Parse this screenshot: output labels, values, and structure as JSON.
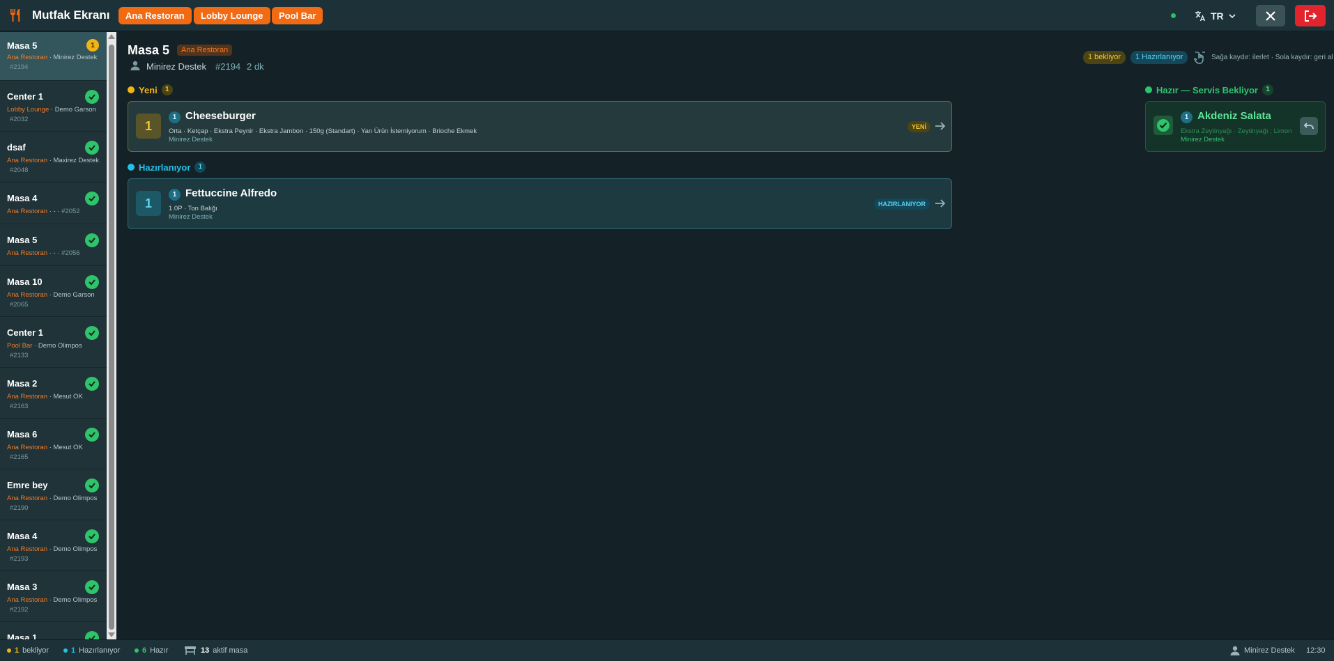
{
  "header": {
    "title": "Mutfak Ekranı",
    "areas": [
      "Ana Restoran",
      "Lobby Lounge",
      "Pool Bar"
    ],
    "language": "TR"
  },
  "orders": [
    {
      "name": "Masa 5",
      "area": "Ana Restoran",
      "waiter": "Minirez Destek",
      "number": "#2194",
      "status": "pending",
      "badge": "1"
    },
    {
      "name": "Center 1",
      "area": "Lobby Lounge",
      "waiter": "Demo Garson",
      "number": "#2032",
      "status": "done"
    },
    {
      "name": "dsaf",
      "area": "Ana Restoran",
      "waiter": "Maxirez Destek",
      "number": "#2048",
      "status": "done"
    },
    {
      "name": "Masa 4",
      "area": "Ana Restoran",
      "waiter": "-",
      "number": "#2052",
      "status": "done"
    },
    {
      "name": "Masa 5",
      "area": "Ana Restoran",
      "waiter": "-",
      "number": "#2056",
      "status": "done"
    },
    {
      "name": "Masa 10",
      "area": "Ana Restoran",
      "waiter": "Demo Garson",
      "number": "#2065",
      "status": "done"
    },
    {
      "name": "Center 1",
      "area": "Pool Bar",
      "waiter": "Demo Olimpos",
      "number": "#2133",
      "status": "done"
    },
    {
      "name": "Masa 2",
      "area": "Ana Restoran",
      "waiter": "Mesut OK",
      "number": "#2163",
      "status": "done"
    },
    {
      "name": "Masa 6",
      "area": "Ana Restoran",
      "waiter": "Mesut OK",
      "number": "#2165",
      "status": "done"
    },
    {
      "name": "Emre bey",
      "area": "Ana Restoran",
      "waiter": "Demo Olimpos",
      "number": "#2190",
      "status": "done"
    },
    {
      "name": "Masa 4",
      "area": "Ana Restoran",
      "waiter": "Demo Olimpos",
      "number": "#2193",
      "status": "done"
    },
    {
      "name": "Masa 3",
      "area": "Ana Restoran",
      "waiter": "Demo Olimpos",
      "number": "#2192",
      "status": "done"
    },
    {
      "name": "Masa 1",
      "area": "",
      "waiter": "",
      "number": "",
      "status": "done"
    }
  ],
  "detail": {
    "title": "Masa 5",
    "area": "Ana Restoran",
    "waiter": "Minirez Destek",
    "order_no": "#2194",
    "elapsed": "2 dk",
    "pill_waiting": "1 bekliyor",
    "pill_preparing": "1 Hazırlanıyor",
    "swipe_hint": "Sağa kaydır: ilerlet · Sola kaydır: geri al"
  },
  "sections": {
    "new": {
      "label": "Yeni",
      "count": "1"
    },
    "preparing": {
      "label": "Hazırlanıyor",
      "count": "1"
    },
    "ready": {
      "label": "Hazır — Servis Bekliyor",
      "count": "1"
    }
  },
  "items": {
    "new": {
      "qty": "1",
      "name": "Cheeseburger",
      "mods": "Orta · Ketçap · Ekstra Peynir · Ekstra Jambon · 150g (Standart) · Yan Ürün İstemiyorum · Brioche Ekmek",
      "waiter": "Minirez Destek",
      "status": "YENİ"
    },
    "preparing": {
      "qty": "1",
      "name": "Fettuccine Alfredo",
      "mods": "1.0P · Ton Balığı",
      "waiter": "Minirez Destek",
      "status": "HAZIRLANIYOR"
    },
    "ready": {
      "qty": "1",
      "name": "Akdeniz Salata",
      "mods": "Ekstra Zeytinyağı · Zeytinyağı ; Limon",
      "waiter": "Minirez Destek"
    }
  },
  "footer": {
    "waiting_count": "1",
    "waiting_label": "bekliyor",
    "preparing_count": "1",
    "preparing_label": "Hazırlanıyor",
    "ready_count": "6",
    "ready_label": "Hazır",
    "active_count": "13",
    "active_label": "aktif masa",
    "user": "Minirez Destek",
    "time": "12:30"
  },
  "colors": {
    "accent": "#f26a12",
    "new": "#f2b413",
    "preparing": "#22c1e6",
    "ready": "#2fc36c",
    "danger": "#e2252d"
  }
}
